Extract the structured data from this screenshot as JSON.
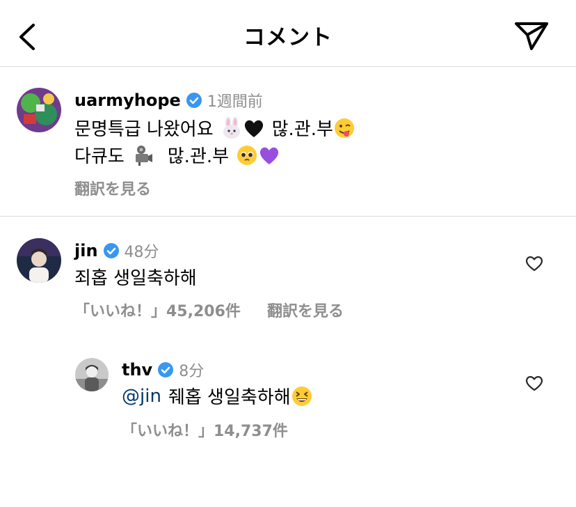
{
  "header": {
    "title": "コメント",
    "back_icon": "chevron-left-icon",
    "share_icon": "paper-plane-icon"
  },
  "colors": {
    "text": "#000000",
    "secondary": "#8e8e8e",
    "verified": "#3897f0",
    "mention": "#00376b",
    "divider": "#dbdbdb"
  },
  "caption": {
    "username": "uarmyhope",
    "verified": true,
    "time": "1週間前",
    "line1_text": "문명특급 나왔어요",
    "line1_emojis": [
      "rabbit-face-icon",
      "black-heart-icon"
    ],
    "line1_tail": "많.관.부",
    "line1_end_emoji": "winking-tongue-face-icon",
    "line2_text": "다큐도",
    "line2_emoji": "movie-camera-icon",
    "line2_tail": "많.관.부",
    "line2_emojis": [
      "pleading-face-icon",
      "purple-heart-icon"
    ],
    "translate": "翻訳を見る"
  },
  "comments": [
    {
      "username": "jin",
      "verified": true,
      "time": "48分",
      "text": "죄홉 생일축하해",
      "likes": "「いいね！」45,206件",
      "translate": "翻訳を見る"
    },
    {
      "username": "thv",
      "verified": true,
      "time": "8分",
      "mention": "@jin",
      "text": "줴홉 생일축하해",
      "emoji": "grinning-squinting-face-icon",
      "likes": "「いいね！」14,737件"
    }
  ]
}
